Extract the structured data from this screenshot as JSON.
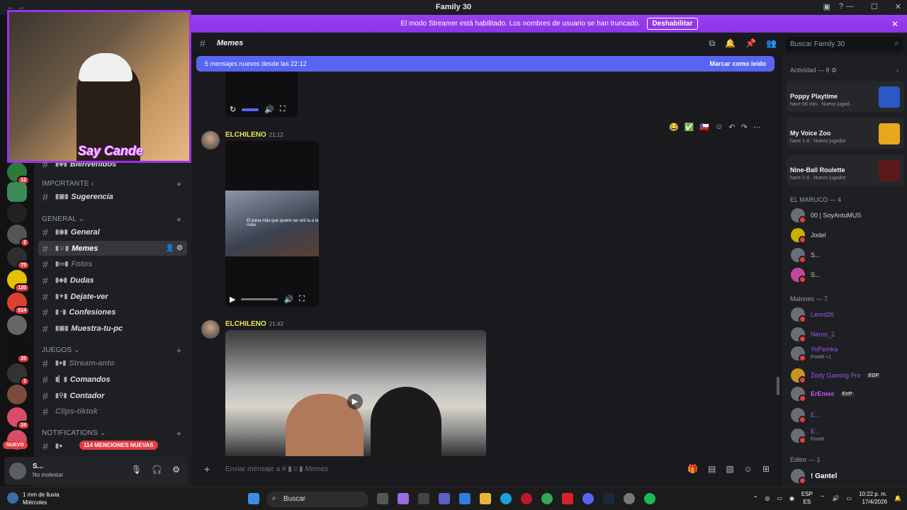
{
  "window": {
    "title": "Family 30",
    "nav": "←  →"
  },
  "banner": {
    "text": "El modo Streamer está habilitado. Los nombres de usuario se han truncado.",
    "button": "Deshabilitar",
    "close": "✕"
  },
  "servers": {
    "badges": [
      "12",
      "2",
      "75",
      "120",
      "514",
      "20",
      "1",
      "24"
    ],
    "nuevo": "NUEVO",
    "mentions": "114 MENCIONES NUEVAS"
  },
  "webcam": {
    "logo": "Say Cande"
  },
  "channels": {
    "partial": "Bienvenidos",
    "categories": {
      "importante": "IMPORTANTE",
      "general": "GENERAL",
      "juegos": "JUEGOS",
      "notifications": "NOTIFICATIONS"
    },
    "items": {
      "sugerencia": "Sugerencia",
      "general": "General",
      "memes": "Memes",
      "fotos": "Fotos",
      "dudas": "Dudas",
      "dejate": "Dejate-ver",
      "confesiones": "Confesiones",
      "muestra": "Muestra-tu-pc",
      "stream": "Stream-anto",
      "comandos": "Comandos",
      "contador": "Contador",
      "clips": "Clips-tiktok"
    }
  },
  "user": {
    "name": "S...",
    "status": "No molestar"
  },
  "header": {
    "channel": "Memes",
    "search_placeholder": "Buscar Family 30"
  },
  "newmsg": {
    "text": "5 mensajes nuevos desde las 22:12",
    "action": "Marcar como leído"
  },
  "messages": [
    {
      "author": "ELCHILENO",
      "time": "21:12",
      "video_caption": "El pana más que quiere ser\narti ta a la maia"
    },
    {
      "author": "ELCHILENO",
      "time": "21:42"
    }
  ],
  "composer": {
    "placeholder": "Enviar mensaje a #",
    "channel": "Memes"
  },
  "members": {
    "activity_head": "Actividad — 8",
    "activities": [
      {
        "title": "Poppy Playtime",
        "time": "hace 56 min",
        "tag": "Nuevo jugad..."
      },
      {
        "title": "My Voice Zoo",
        "time": "hace 1 d",
        "tag": "Nuevo jugador"
      },
      {
        "title": "Nine-Ball Roulette",
        "time": "hace 2 d",
        "tag": "Nuevo jugador"
      }
    ],
    "group1": "EL MARUCO — 4",
    "group1_members": [
      "00 | SoyAntuMUS",
      "Jodel",
      "S...",
      "S..."
    ],
    "group2": "Malones — 7",
    "group2_members": [
      "Leord26",
      "Nemo_2",
      "YoPemka",
      "Zody Gaming Pro",
      "ErEniee",
      "E...",
      "E..."
    ],
    "group2_subs": {
      "yopemka": "FiveM +1",
      "last": "FiveM"
    },
    "group2_tags": {
      "zody": "EGP",
      "ereniee": "ErrP"
    },
    "group3": "Editor — 1",
    "group3_members": [
      "! Gantel"
    ]
  },
  "taskbar": {
    "weather_line1": "1 mm de lluvia",
    "weather_line2": "Miércoles",
    "search": "Buscar",
    "lang1": "ESP",
    "lang2": "ES",
    "time": "10:22 p. m.",
    "date": "17/4/2026"
  }
}
